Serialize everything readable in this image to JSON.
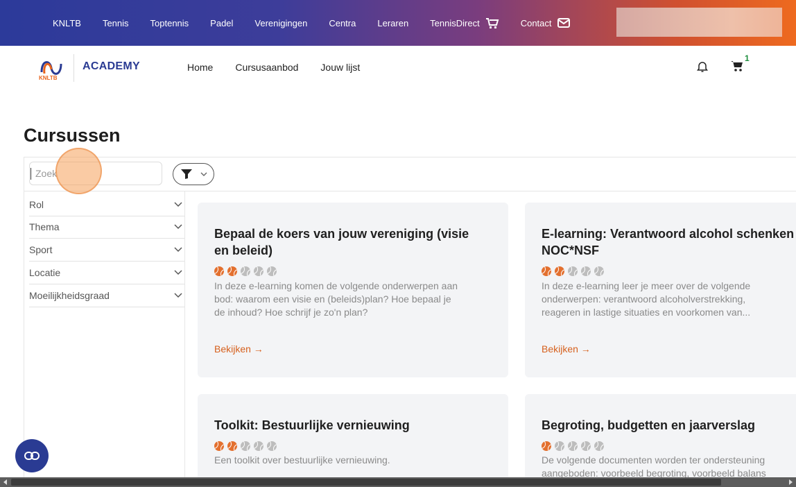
{
  "topnav": {
    "items": [
      "KNLTB",
      "Tennis",
      "Toptennis",
      "Padel",
      "Verenigingen",
      "Centra",
      "Leraren",
      "TennisDirect",
      "Contact"
    ],
    "tennisdirect_icon": "cart-icon",
    "contact_icon": "mail-icon"
  },
  "header": {
    "logo_text": "KNLTB",
    "brand": "ACADEMY",
    "nav": [
      "Home",
      "Cursusaanbod",
      "Jouw lijst"
    ],
    "cart_count": "1"
  },
  "page": {
    "title": "Cursussen",
    "search_placeholder": "Zoek"
  },
  "filters": [
    "Rol",
    "Thema",
    "Sport",
    "Locatie",
    "Moeilijkheidsgraad"
  ],
  "courses": [
    {
      "title_line1": "Bepaal de koers van jouw vereniging (visie",
      "title_line2": "en beleid)",
      "difficulty": 2,
      "desc_lines": [
        "In deze e-learning komen de volgende onderwerpen aan",
        "bod: waarom een visie en (beleids)plan? Hoe bepaal je",
        "de inhoud? Hoe schrijf je zo'n plan?"
      ],
      "link": "Bekijken →"
    },
    {
      "title_line1": "E-learning: Verantwoord alcohol schenken",
      "title_line2": "NOC*NSF",
      "difficulty": 2,
      "desc_lines": [
        "In deze e-learning leer je meer over de volgende",
        "onderwerpen: verantwoord alcoholverstrekking,",
        "reageren in lastige situaties en voorkomen van..."
      ],
      "link": "Bekijken →"
    },
    {
      "title_line1": "Toolkit: Bestuurlijke vernieuwing",
      "difficulty": 2,
      "desc_lines": [
        "Een toolkit over bestuurlijke vernieuwing."
      ]
    },
    {
      "title_line1": "Begroting, budgetten en jaarverslag",
      "difficulty": 1,
      "desc_lines": [
        "De volgende documenten worden ter ondersteuning",
        "aangeboden: voorbeeld begroting, voorbeeld balans"
      ]
    }
  ],
  "colors": {
    "brand_blue": "#2a3b93",
    "accent_orange": "#d6601d",
    "badge_green": "#1e8e3e"
  }
}
